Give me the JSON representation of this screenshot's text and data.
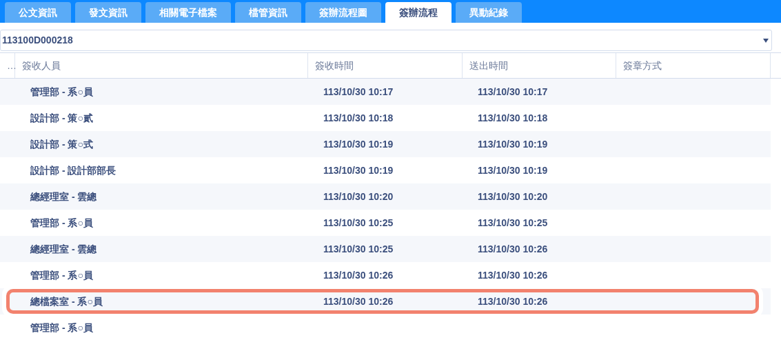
{
  "tabs": [
    {
      "label": "公文資訊",
      "selected": false
    },
    {
      "label": "發文資訊",
      "selected": false
    },
    {
      "label": "相關電子檔案",
      "selected": false
    },
    {
      "label": "檔管資訊",
      "selected": false
    },
    {
      "label": "簽辦流程圖",
      "selected": false
    },
    {
      "label": "簽辦流程",
      "selected": true
    },
    {
      "label": "異動紀錄",
      "selected": false
    }
  ],
  "document_select": {
    "value": "113100D000218"
  },
  "table": {
    "columns": [
      "…",
      "簽收人員",
      "簽收時間",
      "送出時間",
      "簽章方式"
    ],
    "rows": [
      {
        "person": "管理部 - 系○員",
        "received": "113/10/30 10:17",
        "sent": "113/10/30 10:17",
        "highlighted": false
      },
      {
        "person": "設計部 - 策○貳",
        "received": "113/10/30 10:18",
        "sent": "113/10/30 10:18",
        "highlighted": false
      },
      {
        "person": "設計部 - 策○式",
        "received": "113/10/30 10:19",
        "sent": "113/10/30 10:19",
        "highlighted": false
      },
      {
        "person": "設計部 - 設計部部長",
        "received": "113/10/30 10:19",
        "sent": "113/10/30 10:19",
        "highlighted": false
      },
      {
        "person": "總經理室 - 雲總",
        "received": "113/10/30 10:20",
        "sent": "113/10/30 10:20",
        "highlighted": false
      },
      {
        "person": "管理部 - 系○員",
        "received": "113/10/30 10:25",
        "sent": "113/10/30 10:25",
        "highlighted": false
      },
      {
        "person": "總經理室 - 雲總",
        "received": "113/10/30 10:25",
        "sent": "113/10/30 10:26",
        "highlighted": false
      },
      {
        "person": "管理部 - 系○員",
        "received": "113/10/30 10:26",
        "sent": "113/10/30 10:26",
        "highlighted": false
      },
      {
        "person": "總檔案室 - 系○員",
        "received": "113/10/30 10:26",
        "sent": "113/10/30 10:26",
        "highlighted": true
      },
      {
        "person": "管理部 - 系○員",
        "highlighted": false
      }
    ]
  }
}
